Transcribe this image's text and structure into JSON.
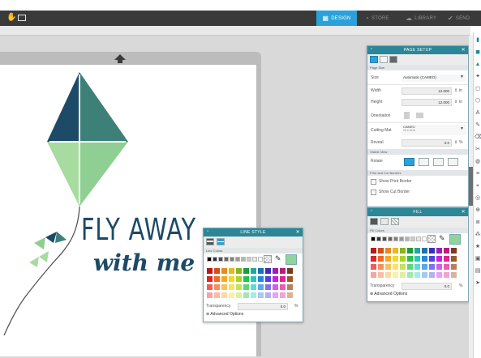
{
  "topbar": {
    "left_icons": [
      "hand-icon",
      "panel-toggle-icon"
    ],
    "tabs": [
      {
        "label": "DESIGN",
        "icon": "design-grid-icon",
        "active": true
      },
      {
        "label": "STORE",
        "icon": "store-icon",
        "active": false
      },
      {
        "label": "LIBRARY",
        "icon": "cloud-icon",
        "active": false
      },
      {
        "label": "SEND",
        "icon": "send-icon",
        "active": false
      }
    ]
  },
  "design": {
    "line1": "FLY AWAY",
    "line2": "with me",
    "colors": {
      "navy": "#1d4a66",
      "teal": "#3d8078",
      "mint": "#a8dba0",
      "darktext": "#1d4a66"
    }
  },
  "page_setup": {
    "title": "PAGE SETUP",
    "section_page_size": "Page Size",
    "size_label": "Size",
    "size_value": "Automatic (CAMEO)",
    "width_label": "Width",
    "width_value": "12.000",
    "width_unit": "in",
    "height_label": "Height",
    "height_value": "12.000",
    "height_unit": "in",
    "orientation_label": "Orientation",
    "cutting_mat_label": "Cutting Mat",
    "cutting_mat_value_line1": "CAMEO",
    "cutting_mat_value_line2": "12 x 12 in",
    "reveal_label": "Reveal",
    "reveal_value": "0.0",
    "reveal_unit": "%",
    "section_visible_view": "Visible View",
    "rotate_label": "Rotate",
    "section_borders": "Print and Cut Borders",
    "show_print_border": "Show Print Border",
    "show_cut_border": "Show Cut Border"
  },
  "fill": {
    "title": "FILL",
    "section": "Fill Colors",
    "transparency_label": "Transparency",
    "transparency_value": "0.0",
    "transparency_unit": "%",
    "advanced": "Advanced Options",
    "selected_color": "#90d39c"
  },
  "line_style": {
    "title": "LINE STYLE",
    "section": "Line Colors",
    "transparency_label": "Transparency",
    "transparency_value": "0.0",
    "transparency_unit": "%",
    "advanced": "Advanced Options",
    "selected_color": "#90d39c"
  },
  "palette": {
    "grays": [
      "#000000",
      "#333333",
      "#4d4d4d",
      "#666666",
      "#808080",
      "#999999",
      "#b3b3b3",
      "#cccccc",
      "#e6e6e6",
      "#ffffff"
    ],
    "rows": [
      [
        "#b31b1b",
        "#d64a1c",
        "#e58a1f",
        "#e5b81f",
        "#86b51f",
        "#1f9b3b",
        "#1fa89c",
        "#1f6fb5",
        "#3a2fb5",
        "#9b1fb5",
        "#b51f7a",
        "#7a3a1f"
      ],
      [
        "#e02424",
        "#f26a21",
        "#f7a823",
        "#f7d823",
        "#a6d623",
        "#23c24a",
        "#23c9c0",
        "#2388e0",
        "#4f42e0",
        "#c223e0",
        "#e0238f",
        "#9b5a2d"
      ],
      [
        "#f25c5c",
        "#f78f5c",
        "#fbbf5c",
        "#fbe45c",
        "#c1e45c",
        "#5cd67a",
        "#5cdcd4",
        "#5ca6ec",
        "#7e73ec",
        "#d45cec",
        "#ec5caf",
        "#b5825c"
      ],
      [
        "#f7a3a3",
        "#fbbca3",
        "#fdd8a3",
        "#fdefa3",
        "#dcefa3",
        "#a3e6b5",
        "#a3ebe6",
        "#a3c9f4",
        "#b5aff4",
        "#e6a3f4",
        "#f4a3d1",
        "#d6b59b"
      ]
    ]
  },
  "right_tools": [
    "select-icon",
    "node-icon",
    "pan-icon",
    "zoom-icon",
    "grid-icon",
    "shape-icon",
    "text-icon",
    "draw-icon",
    "eraser-icon",
    "knife-icon",
    "fill-icon",
    "layers-icon",
    "trace-icon",
    "offset-icon",
    "weld-icon",
    "align-icon",
    "replicate-icon",
    "star-icon",
    "image-icon",
    "library-icon",
    "send-icon"
  ]
}
